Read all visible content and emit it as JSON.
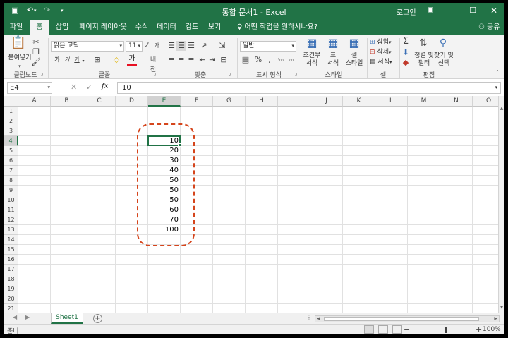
{
  "title_bar": {
    "title": "통합 문서1 - Excel",
    "login": "로그인",
    "accent": "#217346"
  },
  "tabs": [
    {
      "label": "파일"
    },
    {
      "label": "홈"
    },
    {
      "label": "삽입"
    },
    {
      "label": "페이지 레이아웃"
    },
    {
      "label": "수식"
    },
    {
      "label": "데이터"
    },
    {
      "label": "검토"
    },
    {
      "label": "보기"
    }
  ],
  "tell_me": "어떤 작업을 원하시나요?",
  "share": "공유",
  "ribbon": {
    "clipboard": {
      "paste": "붙여넣기",
      "label": "클립보드"
    },
    "font": {
      "name": "맑은 고딕",
      "size": "11",
      "bold": "가",
      "italic": "가",
      "underline": "가",
      "label": "글꼴",
      "phonetic": "내천"
    },
    "alignment": {
      "label": "맞춤"
    },
    "number": {
      "format": "일반",
      "percent": "%",
      "label": "표시 형식"
    },
    "styles": {
      "conditional": "조건부\n서식",
      "table": "표\n서식",
      "cell": "셀\n스타일",
      "label": "스타일"
    },
    "cells": {
      "insert": "삽입",
      "delete": "삭제",
      "format": "서식",
      "label": "셀"
    },
    "editing": {
      "sort": "정렬 및\n필터",
      "find": "찾기 및\n선택",
      "label": "편집"
    }
  },
  "formula_bar": {
    "name_box": "E4",
    "value": "10"
  },
  "columns": [
    "A",
    "B",
    "C",
    "D",
    "E",
    "F",
    "G",
    "H",
    "I",
    "J",
    "K",
    "L",
    "M",
    "N",
    "O"
  ],
  "rows": [
    "1",
    "2",
    "3",
    "4",
    "5",
    "6",
    "7",
    "8",
    "9",
    "10",
    "11",
    "12",
    "13",
    "14",
    "15",
    "16",
    "17",
    "18",
    "19",
    "20",
    "21"
  ],
  "cells_E": [
    {
      "row": "4",
      "value": "10"
    },
    {
      "row": "5",
      "value": "20"
    },
    {
      "row": "6",
      "value": "30"
    },
    {
      "row": "7",
      "value": "40"
    },
    {
      "row": "8",
      "value": "50"
    },
    {
      "row": "9",
      "value": "50"
    },
    {
      "row": "10",
      "value": "50"
    },
    {
      "row": "11",
      "value": "60"
    },
    {
      "row": "12",
      "value": "70"
    },
    {
      "row": "13",
      "value": "100"
    }
  ],
  "selected_cell": "E4",
  "annotation_color": "#d5451c",
  "sheet_tab": "Sheet1",
  "status": {
    "ready": "준비",
    "zoom": "100%"
  }
}
